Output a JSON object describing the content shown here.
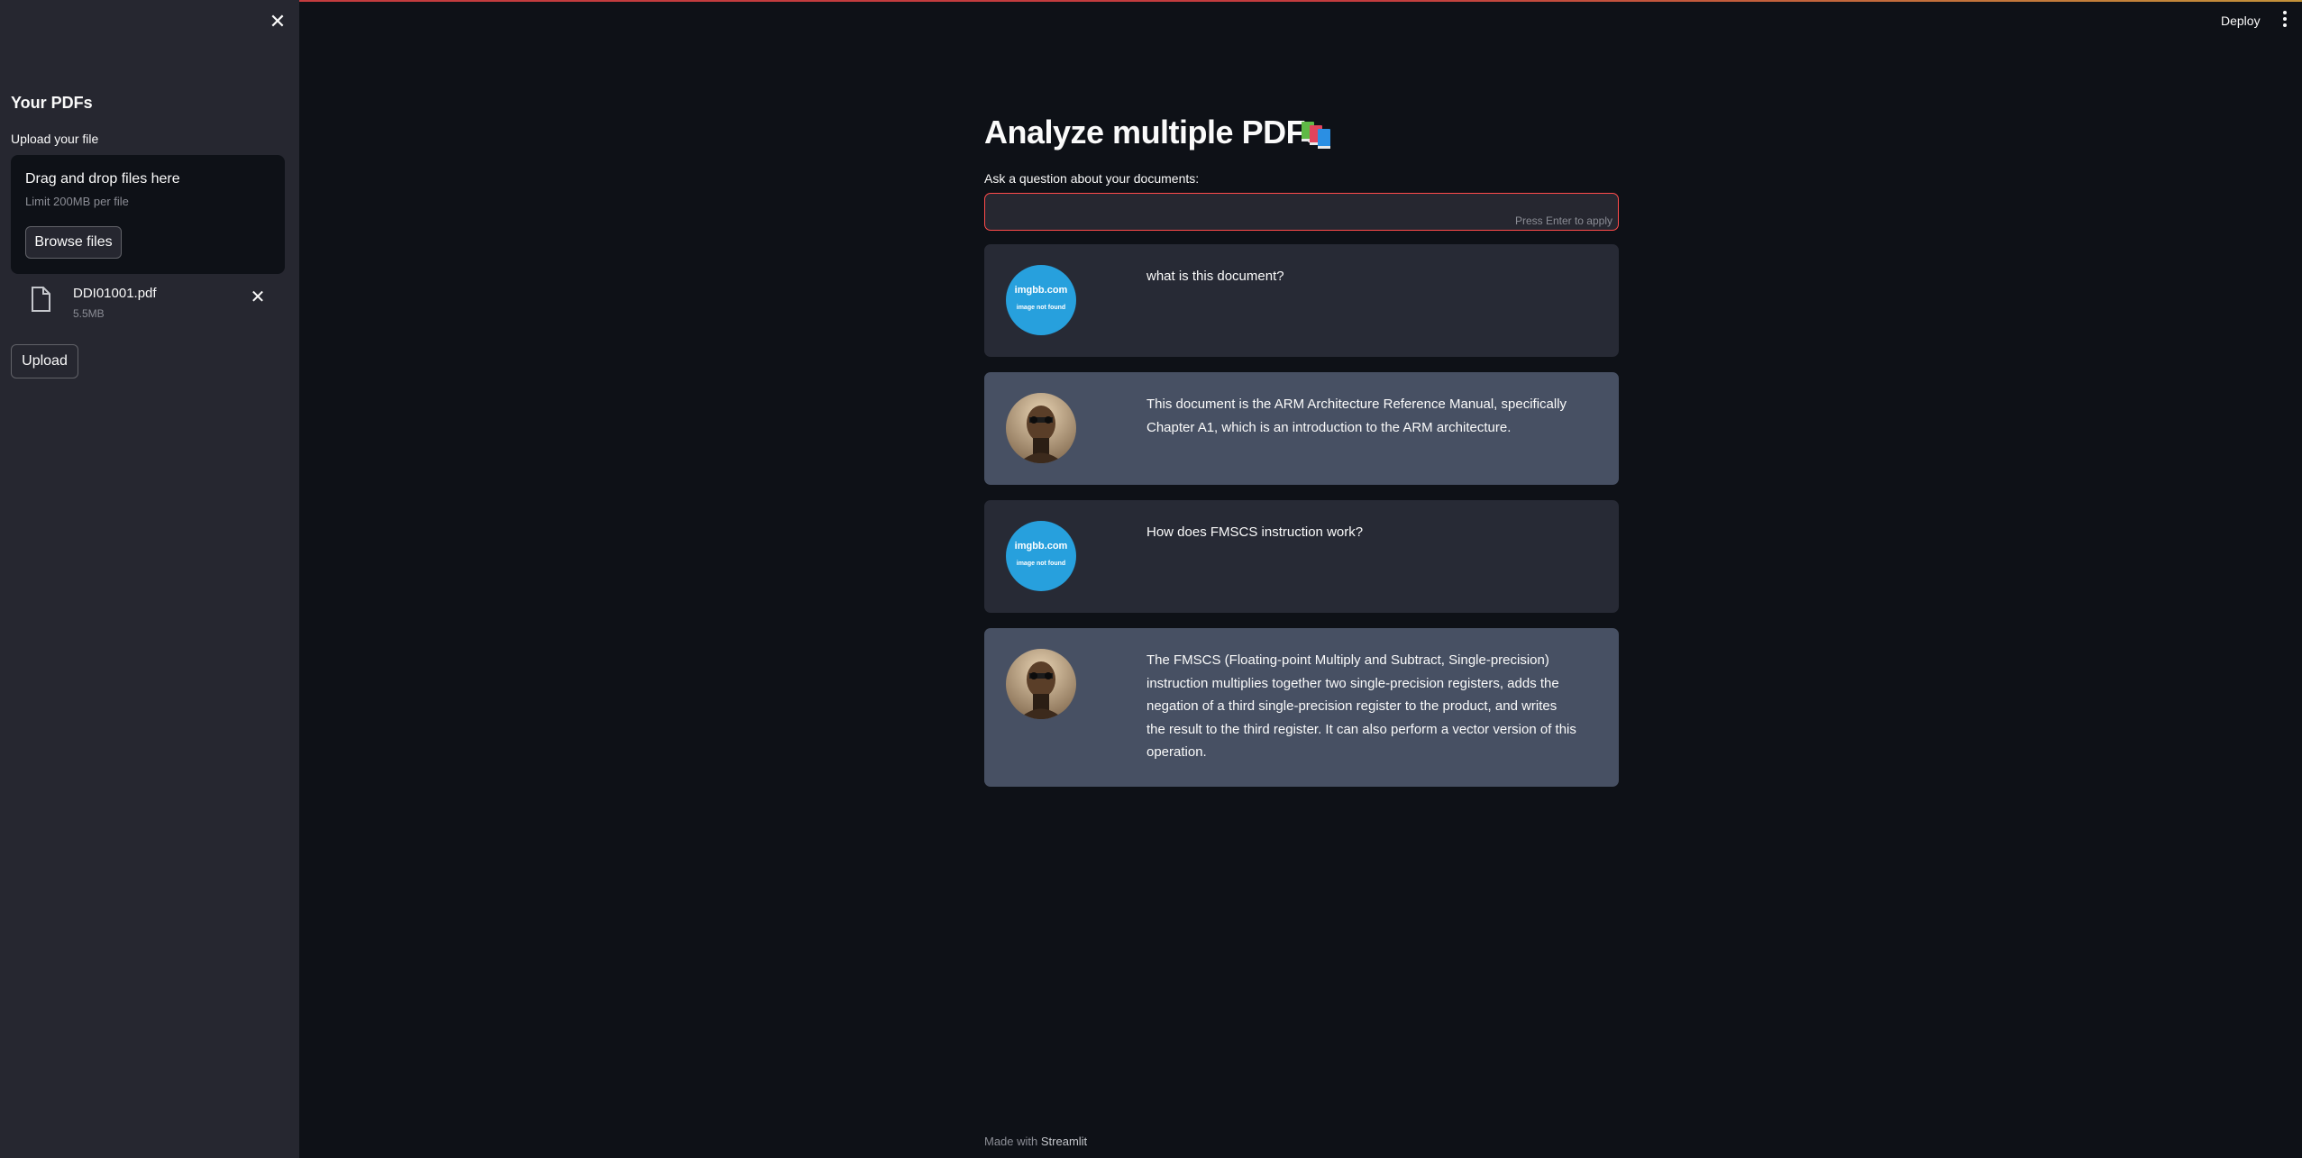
{
  "sidebar": {
    "title": "Your PDFs",
    "upload_label": "Upload your file",
    "dropzone": {
      "title": "Drag and drop files here",
      "limit": "Limit 200MB per file",
      "browse_label": "Browse files"
    },
    "file": {
      "name": "DDI01001.pdf",
      "size": "5.5MB"
    },
    "upload_button": "Upload"
  },
  "header": {
    "deploy_label": "Deploy"
  },
  "main": {
    "title": "Analyze multiple PDFs",
    "question_label": "Ask a question about your documents:",
    "input_value": "",
    "input_hint": "Press Enter to apply"
  },
  "messages": [
    {
      "role": "user",
      "avatar_text1": "imgbb.com",
      "avatar_text2": "image not found",
      "text": "what is this document?"
    },
    {
      "role": "bot",
      "text": "This document is the ARM Architecture Reference Manual, specifically Chapter A1, which is an introduction to the ARM architecture."
    },
    {
      "role": "user",
      "avatar_text1": "imgbb.com",
      "avatar_text2": "image not found",
      "text": "How does FMSCS instruction work?"
    },
    {
      "role": "bot",
      "text": "The FMSCS (Floating-point Multiply and Subtract, Single-precision) instruction multiplies together two single-precision registers, adds the negation of a third single-precision register to the product, and writes the result to the third register. It can also perform a vector version of this operation."
    }
  ],
  "footer": {
    "prefix": "Made with",
    "brand": "Streamlit"
  },
  "colors": {
    "accent": "#ff4b4b",
    "background": "#0e1117",
    "sidebar": "#262730",
    "user_msg": "#272a35",
    "bot_msg": "#475063",
    "imgbb_avatar": "#27a0dd"
  }
}
